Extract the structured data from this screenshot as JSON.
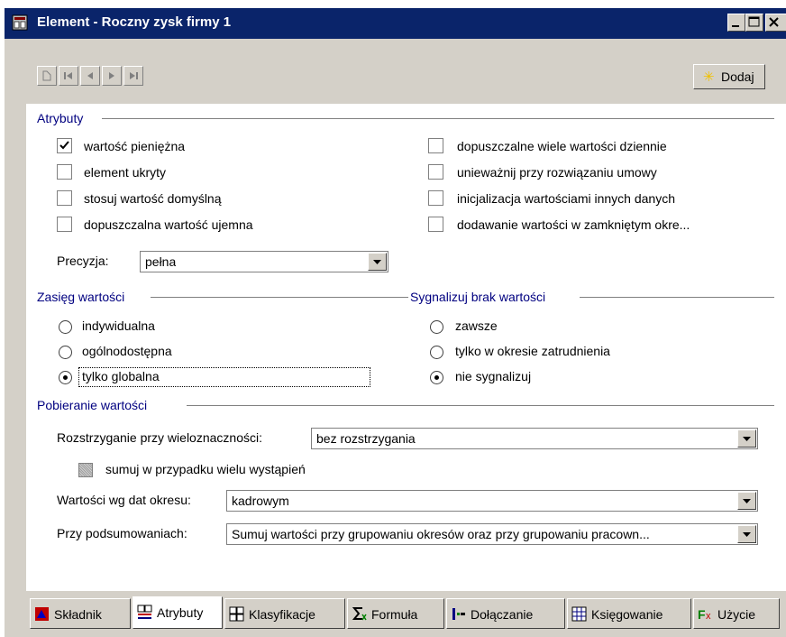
{
  "window": {
    "title": "Element - Roczny zysk firmy 1"
  },
  "toolbar": {
    "add_label": "Dodaj"
  },
  "attributes": {
    "title": "Atrybuty",
    "left": [
      {
        "label": "wartość pieniężna",
        "checked": true
      },
      {
        "label": "element ukryty",
        "checked": false
      },
      {
        "label": "stosuj wartość domyślną",
        "checked": false
      },
      {
        "label": "dopuszczalna wartość ujemna",
        "checked": false
      }
    ],
    "right": [
      {
        "label": "dopuszczalne wiele wartości dziennie",
        "checked": false
      },
      {
        "label": "unieważnij przy rozwiązaniu umowy",
        "checked": false
      },
      {
        "label": "inicjalizacja wartościami innych danych",
        "checked": false
      },
      {
        "label": "dodawanie wartości w zamkniętym okre...",
        "checked": false
      }
    ],
    "precision_label": "Precyzja:",
    "precision_value": "pełna"
  },
  "scope": {
    "title": "Zasięg wartości",
    "options": [
      "indywidualna",
      "ogólnodostępna",
      "tylko globalna"
    ],
    "selected": 2
  },
  "signal": {
    "title": "Sygnalizuj brak wartości",
    "options": [
      "zawsze",
      "tylko w okresie zatrudnienia",
      "nie sygnalizuj"
    ],
    "selected": 2
  },
  "retrieval": {
    "title": "Pobieranie wartości",
    "ambiguity_label": "Rozstrzyganie przy wieloznaczności:",
    "ambiguity_value": "bez rozstrzygania",
    "sum_label": "sumuj w przypadku wielu wystąpień",
    "dates_label": "Wartości wg dat okresu:",
    "dates_value": "kadrowym",
    "summary_label": "Przy podsumowaniach:",
    "summary_value": "Sumuj wartości przy grupowaniu okresów oraz przy grupowaniu pracown..."
  },
  "tabs": [
    {
      "label": "Składnik",
      "icon": "component-icon"
    },
    {
      "label": "Atrybuty",
      "icon": "attributes-icon",
      "active": true
    },
    {
      "label": "Klasyfikacje",
      "icon": "classification-icon"
    },
    {
      "label": "Formuła",
      "icon": "formula-icon"
    },
    {
      "label": "Dołączanie",
      "icon": "attach-icon"
    },
    {
      "label": "Księgowanie",
      "icon": "accounting-icon"
    },
    {
      "label": "Użycie",
      "icon": "usage-icon"
    }
  ],
  "colors": {
    "titlebar": "#0a246a",
    "section_title": "#000080",
    "face": "#d4d0c8"
  }
}
